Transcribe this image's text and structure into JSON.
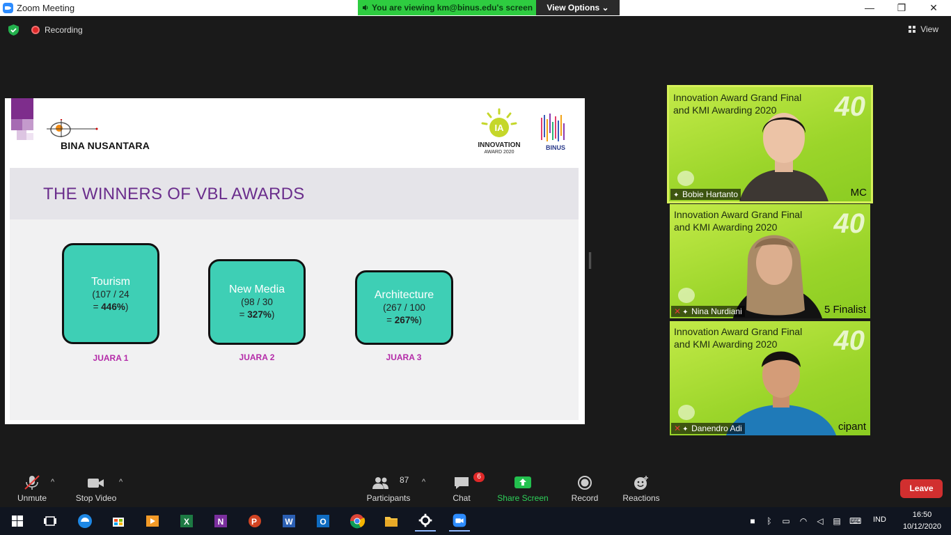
{
  "window": {
    "title": "Zoom Meeting",
    "minimize": "—",
    "restore": "❐",
    "close": "✕"
  },
  "banner": {
    "viewing_text": "You are viewing km@binus.edu's screen",
    "view_options_label": "View Options ⌄"
  },
  "meeting_bar": {
    "recording_label": "Recording",
    "view_label": "View"
  },
  "slide": {
    "brand_name": "BINA NUSANTARA",
    "ia_logo_line1": "INNOVATION",
    "ia_logo_line2": "AWARD 2020",
    "binus_logo_text": "BINUS",
    "title": "THE WINNERS OF VBL AWARDS",
    "awards": [
      {
        "category": "Tourism",
        "ratio": "(107 / 24",
        "result_prefix": "= ",
        "result_value": "446%",
        "result_suffix": ")",
        "rank": "JUARA 1"
      },
      {
        "category": "New Media",
        "ratio": "(98 / 30",
        "result_prefix": "= ",
        "result_value": "327%",
        "result_suffix": ")",
        "rank": "JUARA 2"
      },
      {
        "category": "Architecture",
        "ratio": "(267 / 100",
        "result_prefix": "= ",
        "result_value": "267%",
        "result_suffix": ")",
        "rank": "JUARA 3"
      }
    ],
    "colors": {
      "title": "#6a2d8c",
      "card": "#3ecfb5",
      "rank": "#b42aa8"
    }
  },
  "participants_video": [
    {
      "background_title_1": "Innovation Award Grand Final",
      "background_title_2": "and KMI Awarding 2020",
      "name": "Bobie Hartanto",
      "role_badge": "MC",
      "muted": false,
      "active_speaker": true
    },
    {
      "background_title_1": "Innovation Award Grand Final",
      "background_title_2": "and KMI Awarding 2020",
      "name": "Nina Nurdiani",
      "role_badge": "5 Finalist",
      "muted": true,
      "active_speaker": false
    },
    {
      "background_title_1": "Innovation Award Grand Final",
      "background_title_2": "and KMI Awarding 2020",
      "name": "Danendro Adi",
      "role_badge": "cipant",
      "muted": true,
      "active_speaker": false
    }
  ],
  "toolbar": {
    "unmute_label": "Unmute",
    "stop_video_label": "Stop Video",
    "participants_label": "Participants",
    "participants_count": "87",
    "chat_label": "Chat",
    "chat_unread": "6",
    "share_screen_label": "Share Screen",
    "record_label": "Record",
    "reactions_label": "Reactions",
    "leave_label": "Leave",
    "caret": "^"
  },
  "taskbar": {
    "language": "IND",
    "time": "16:50",
    "date": "10/12/2020"
  }
}
